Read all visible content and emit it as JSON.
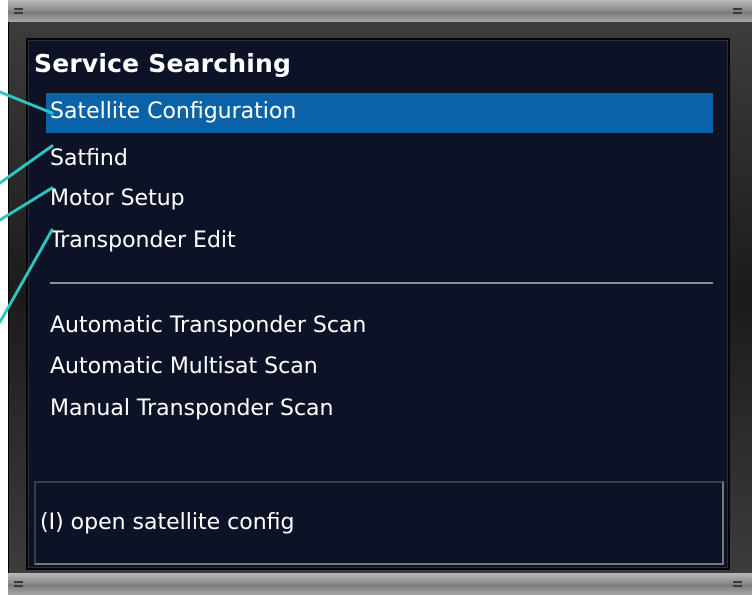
{
  "menu": {
    "title": "Service Searching",
    "items": [
      "Satellite Configuration",
      "Satfind",
      "Motor Setup",
      "Transponder Edit"
    ],
    "scan_items": [
      "Automatic Transponder Scan",
      "Automatic Multisat Scan",
      "Manual Transponder Scan"
    ],
    "selected_index": 0
  },
  "status": {
    "hint": "(I) open satellite config"
  },
  "colors": {
    "background": "#0d1326",
    "highlight": "#0a63a6",
    "callout": "#2fc6c0",
    "text": "#ffffff"
  }
}
